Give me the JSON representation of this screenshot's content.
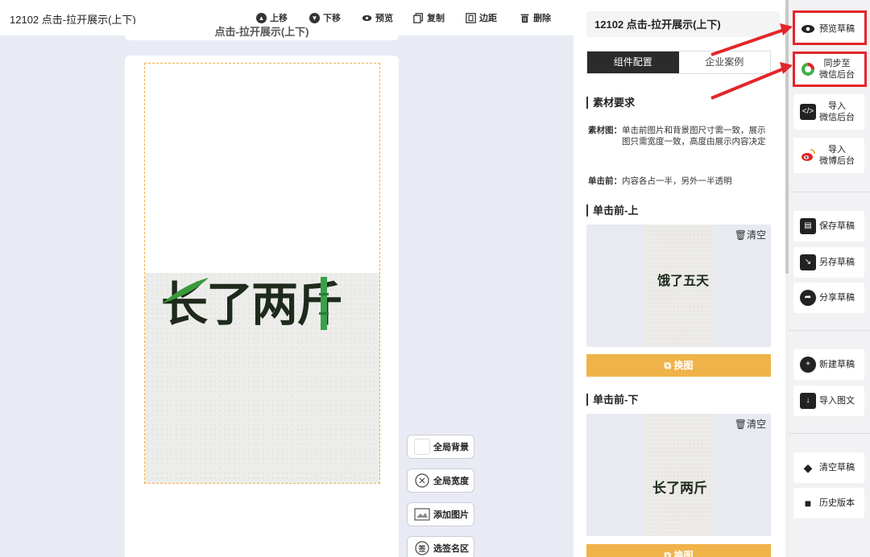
{
  "toolbar": {
    "title": "12102 点击-拉开展示(上下)",
    "up": "上移",
    "down": "下移",
    "preview": "预览",
    "copy": "复制",
    "margin": "边距",
    "delete": "删除"
  },
  "canvas": {
    "header_text": "点击-拉开展示(上下)",
    "main_text": "长了两斤"
  },
  "side_buttons": {
    "global_bg": "全局背景",
    "global_width": "全局宽度",
    "add_image": "添加图片",
    "sign_area": "选签名区"
  },
  "panel": {
    "title": "12102 点击-拉开展示(上下)",
    "tabs": [
      "组件配置",
      "企业案例"
    ],
    "material_title": "素材要求",
    "material_key": "素材图：",
    "material_text": "单击前图片和背景图尺寸需一致，展示图只需宽度一致，高度由展示内容决定",
    "before_key": "单击前：",
    "before_text": "内容各占一半，另外一半透明",
    "upper_title": "单击前-上",
    "upper_clear": "清空",
    "upper_img_text": "饿了五天",
    "swap_label": "换图",
    "lower_title": "单击前-下",
    "lower_clear": "清空",
    "lower_img_text": "长了两斤",
    "swap_label_2": "换图"
  },
  "rail": {
    "preview_draft": "预览草稿",
    "sync_wechat": "同步至\n微信后台",
    "import_wechat": "导入\n微信后台",
    "import_weibo": "导入\n微博后台",
    "save_draft": "保存草稿",
    "save_as": "另存草稿",
    "share_draft": "分享草稿",
    "new_draft": "新建草稿",
    "import_article": "导入图文",
    "clear_draft": "清空草稿",
    "history": "历史版本"
  },
  "colors": {
    "accent_orange": "#f0b34a",
    "highlight_red": "#e3262b",
    "dark_tab": "#2b2b2b"
  }
}
